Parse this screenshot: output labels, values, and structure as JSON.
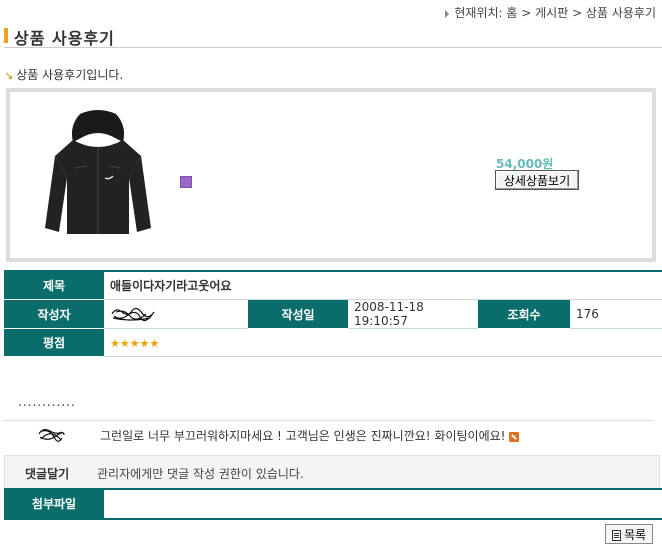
{
  "breadcrumb": {
    "text": "현재위치: 홈 > 게시판 > 상품 사용후기"
  },
  "page": {
    "title": "상품 사용후기",
    "intro": "상품 사용후기입니다."
  },
  "product": {
    "price": "54,000원",
    "detail_button": "상세상품보기",
    "image": "black-hooded-jacket"
  },
  "post": {
    "labels": {
      "subject": "제목",
      "author": "작성자",
      "date": "작성일",
      "views": "조회수",
      "rating": "평점"
    },
    "subject": "애들이다자기라고웃어요",
    "date": "2008-11-18 19:10:57",
    "views": "176",
    "rating": 5,
    "stars": "★★★★★",
    "body": "............"
  },
  "comment": {
    "text": "그런일로 너무 부끄러워하지마세요 ! 고객님은 인생은 진짜니깐요! 화이팅이에요!"
  },
  "reply": {
    "label": "댓글달기",
    "notice": "관리자에게만 댓글 작성 권한이 있습니다."
  },
  "attachment": {
    "label": "첨부파일"
  },
  "footer": {
    "list_button": "목록"
  },
  "colors": {
    "header_bg": "#0a6d6b",
    "accent": "#f0a020",
    "price": "#66bbbb"
  }
}
